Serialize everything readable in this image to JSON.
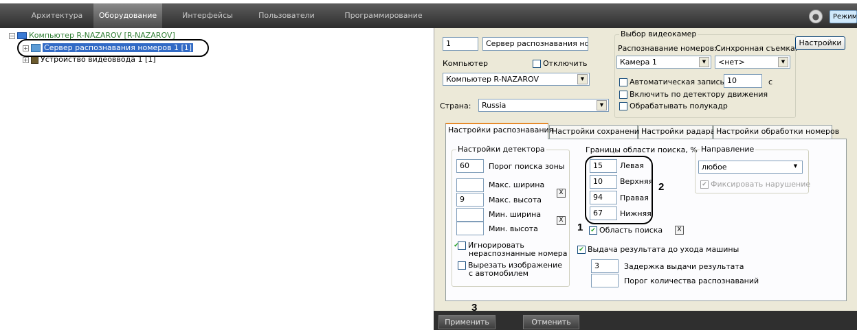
{
  "topbar": {
    "tabs": [
      "Архитектура",
      "Оборудование",
      "Интерфейсы",
      "Пользователи",
      "Программирование"
    ],
    "active_tab": "Оборудование",
    "mode_button": "Режим"
  },
  "tree": {
    "computer": "Компьютер R-NAZAROV [R-NAZAROV]",
    "server": "Сервер распознавания номеров 1 [1]",
    "video_input": "Устройство видеоввода 1 [1]"
  },
  "panel": {
    "id_value": "1",
    "name_value": "Сервер распознавания ном",
    "computer_label": "Компьютер",
    "disable_label": "Отключить",
    "computer_value": "Компьютер R-NAZAROV",
    "country_label": "Страна:",
    "country_value": "Russia",
    "cam_group_title": "Выбор видеокамер",
    "recog_label": "Распознавание номеров:",
    "sync_label": "Синхронная съемка:",
    "camera_value": "Камера 1",
    "sync_value": "<нет>",
    "settings_button": "Настройки",
    "auto_record_label": "Автоматическая запись",
    "auto_record_value": "10",
    "auto_record_unit": "с",
    "motion_label": "Включить по детектору движения",
    "halfframe_label": "Обрабатывать полукадр"
  },
  "tabs": [
    "Настройки распознавания",
    "Настройки сохранения",
    "Настройки радара",
    "Настройки обработки номеров"
  ],
  "detector": {
    "title": "Настройки детектора",
    "threshold_value": "60",
    "threshold_label": "Порог поиска зоны",
    "maxw_value": "",
    "maxw_label": "Макс. ширина",
    "maxh_value": "9",
    "maxh_label": "Макс. высота",
    "minw_value": "",
    "minw_label": "Мин. ширина",
    "minh_value": "",
    "minh_label": "Мин. высота",
    "ignore_label": "Игнорировать нераспознанные номера",
    "cut_label": "Вырезать изображение с автомобилем",
    "x_label": "X"
  },
  "bounds": {
    "title": "Границы области поиска, %",
    "left_value": "15",
    "left_label": "Левая",
    "top_value": "10",
    "top_label": "Верхняя",
    "right_value": "94",
    "right_label": "Правая",
    "bottom_value": "67",
    "bottom_label": "Нижняя",
    "area_label": "Область поиска"
  },
  "direction": {
    "title": "Направление",
    "value": "любое",
    "fix_label": "Фиксировать нарушение"
  },
  "output": {
    "before_leave_label": "Выдача результата до ухода машины",
    "delay_value": "3",
    "delay_label": "Задержка выдачи результата",
    "count_value": "",
    "count_label": "Порог количества распознаваний"
  },
  "footer": {
    "apply": "Применить",
    "cancel": "Отменить"
  },
  "callouts": {
    "one": "1",
    "two": "2",
    "three": "3"
  }
}
